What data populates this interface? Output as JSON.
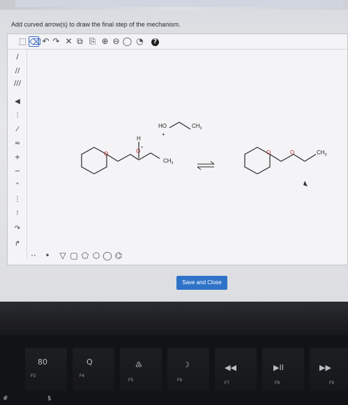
{
  "prompt": "Add curved arrow(s) to draw the final step of the mechanism.",
  "toolbar": {
    "icons": [
      "select-icon",
      "eraser-icon",
      "undo-icon",
      "redo-icon",
      "delete-icon",
      "copy-icon",
      "paste-icon",
      "zoom-in-icon",
      "zoom-out-icon",
      "zoom-reset-icon",
      "help-icon"
    ],
    "help_label": "?"
  },
  "molecules": {
    "reactant_hetero_label": "O",
    "reactant_oxonium_label": "O",
    "reactant_h_label": "H",
    "reactant_plus": "+",
    "reactant_ch3": "CH",
    "reactant_ch3_sub": "3",
    "ethanol_ho": "HO",
    "ethanol_plus": "+",
    "ethanol_ch3": "CH",
    "ethanol_ch3_sub": "3",
    "product_o1": "O",
    "product_o2": "O",
    "product_ch3": "CH",
    "product_ch3_sub": "3"
  },
  "save_button_label": "Save and Close",
  "keyboard": {
    "keys": [
      {
        "fn": "F3",
        "icon": "80"
      },
      {
        "fn": "F4",
        "icon": "Q"
      },
      {
        "fn": "F5",
        "icon": "♴"
      },
      {
        "fn": "F6",
        "icon": "☽"
      },
      {
        "fn": "F7",
        "icon": "◀◀"
      },
      {
        "fn": "F8",
        "icon": "▶II"
      },
      {
        "fn": "F9",
        "icon": "▶▶"
      }
    ],
    "bottom_symbols": [
      "#",
      "$"
    ]
  }
}
